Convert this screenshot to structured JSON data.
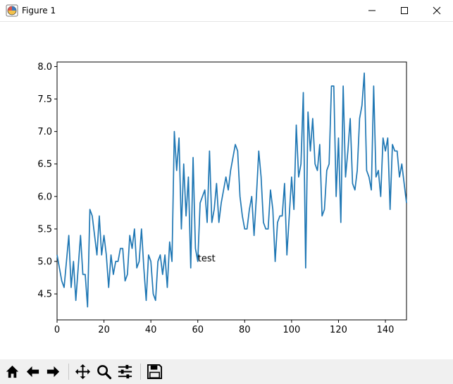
{
  "window": {
    "title": "Figure 1",
    "controls": [
      "minimize",
      "maximize",
      "close"
    ]
  },
  "toolbar": {
    "buttons": [
      {
        "name": "home",
        "icon": "home-icon"
      },
      {
        "name": "back",
        "icon": "arrow-left-icon"
      },
      {
        "name": "forward",
        "icon": "arrow-right-icon"
      },
      {
        "name": "pan",
        "icon": "move-icon"
      },
      {
        "name": "zoom",
        "icon": "magnifier-icon"
      },
      {
        "name": "configure-subplots",
        "icon": "sliders-icon"
      },
      {
        "name": "save",
        "icon": "floppy-disk-icon"
      }
    ]
  },
  "chart_data": {
    "type": "line",
    "title": "",
    "xlabel": "",
    "ylabel": "",
    "xlim": [
      0,
      149
    ],
    "ylim": [
      4.1,
      8.07
    ],
    "xticks": [
      0,
      20,
      40,
      60,
      80,
      100,
      120,
      140
    ],
    "yticks": [
      4.5,
      5.0,
      5.5,
      6.0,
      6.5,
      7.0,
      7.5,
      8.0
    ],
    "grid": false,
    "line_color": "#1f77b4",
    "annotation": {
      "text": "test",
      "x": 60,
      "y": 5.0
    },
    "series": [
      {
        "values": [
          5.1,
          4.9,
          4.7,
          4.6,
          5.0,
          5.4,
          4.6,
          5.0,
          4.4,
          4.9,
          5.4,
          4.8,
          4.8,
          4.3,
          5.8,
          5.7,
          5.4,
          5.1,
          5.7,
          5.1,
          5.4,
          5.1,
          4.6,
          5.1,
          4.8,
          5.0,
          5.0,
          5.2,
          5.2,
          4.7,
          4.8,
          5.4,
          5.2,
          5.5,
          4.9,
          5.0,
          5.5,
          4.9,
          4.4,
          5.1,
          5.0,
          4.5,
          4.4,
          5.0,
          5.1,
          4.8,
          5.1,
          4.6,
          5.3,
          5.0,
          7.0,
          6.4,
          6.9,
          5.5,
          6.5,
          5.7,
          6.3,
          4.9,
          6.6,
          5.2,
          5.0,
          5.9,
          6.0,
          6.1,
          5.6,
          6.7,
          5.6,
          5.8,
          6.2,
          5.6,
          5.9,
          6.1,
          6.3,
          6.1,
          6.4,
          6.6,
          6.8,
          6.7,
          6.0,
          5.7,
          5.5,
          5.5,
          5.8,
          6.0,
          5.4,
          6.0,
          6.7,
          6.3,
          5.6,
          5.5,
          5.5,
          6.1,
          5.8,
          5.0,
          5.6,
          5.7,
          5.7,
          6.2,
          5.1,
          5.7,
          6.3,
          5.8,
          7.1,
          6.3,
          6.5,
          7.6,
          4.9,
          7.3,
          6.7,
          7.2,
          6.5,
          6.4,
          6.8,
          5.7,
          5.8,
          6.4,
          6.5,
          7.7,
          7.7,
          6.0,
          6.9,
          5.6,
          7.7,
          6.3,
          6.7,
          7.2,
          6.2,
          6.1,
          6.4,
          7.2,
          7.4,
          7.9,
          6.4,
          6.3,
          6.1,
          7.7,
          6.3,
          6.4,
          6.0,
          6.9,
          6.7,
          6.9,
          5.8,
          6.8,
          6.7,
          6.7,
          6.3,
          6.5,
          6.2,
          5.9
        ]
      }
    ]
  }
}
